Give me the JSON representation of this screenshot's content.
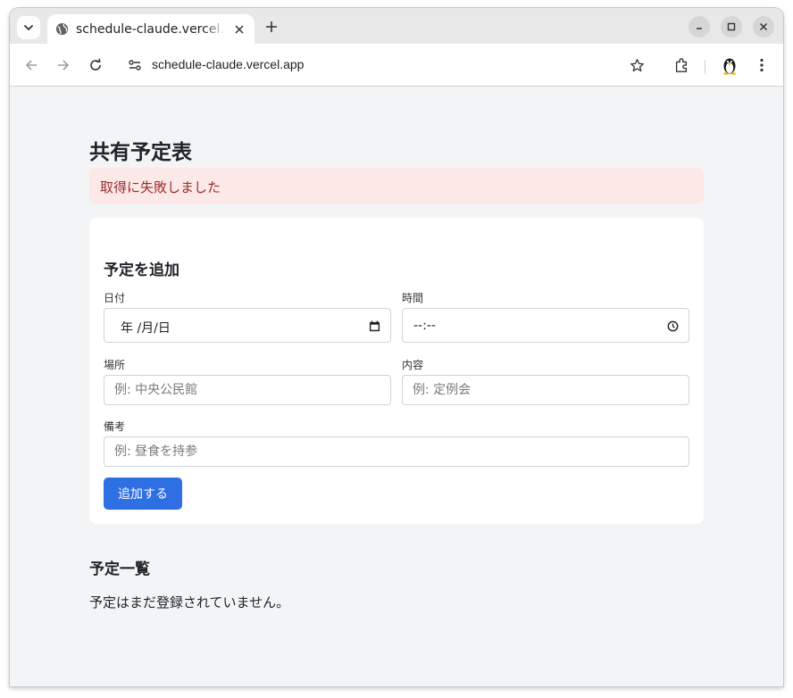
{
  "browser": {
    "tab_title": "schedule-claude.vercel.app",
    "url": "schedule-claude.vercel.app"
  },
  "page": {
    "title": "共有予定表",
    "error_message": "取得に失敗しました",
    "form": {
      "title": "予定を追加",
      "date_label": "日付",
      "date_value": "年 /月/日",
      "time_label": "時間",
      "time_value": "--:--",
      "place_label": "場所",
      "place_placeholder": "例: 中央公民館",
      "content_label": "内容",
      "content_placeholder": "例: 定例会",
      "note_label": "備考",
      "note_placeholder": "例: 昼食を持参",
      "submit_label": "追加する"
    },
    "list": {
      "title": "予定一覧",
      "empty_message": "予定はまだ登録されていません。"
    }
  },
  "colors": {
    "accent": "#2f6fe4",
    "error_bg": "#fde8e8",
    "error_text": "#9b2c2c",
    "page_bg": "#f3f4f6"
  }
}
